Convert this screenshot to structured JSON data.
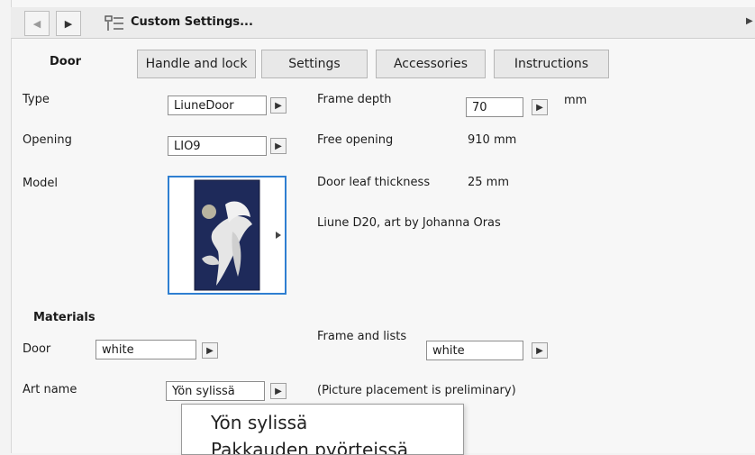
{
  "header": {
    "title": "Custom Settings...",
    "back_icon": "chevron-left",
    "forward_icon": "chevron-right",
    "settings_icon": "custom-settings-icon"
  },
  "tabs": [
    {
      "label": "Door",
      "active": true
    },
    {
      "label": "Handle and lock"
    },
    {
      "label": "Settings"
    },
    {
      "label": "Accessories"
    },
    {
      "label": "Instructions"
    }
  ],
  "left": {
    "type_label": "Type",
    "type_value": "LiuneDoor",
    "opening_label": "Opening",
    "opening_value": "LIO9",
    "model_label": "Model"
  },
  "right": {
    "frame_depth_label": "Frame depth",
    "frame_depth_value": "70",
    "frame_depth_unit": "mm",
    "free_opening_label": "Free opening",
    "free_opening_value": "910 mm",
    "door_leaf_label": "Door leaf thickness",
    "door_leaf_value": "25 mm",
    "model_caption": "Liune D20, art by Johanna Oras"
  },
  "materials": {
    "section_label": "Materials",
    "door_label": "Door",
    "door_value": "white",
    "frame_label": "Frame and lists",
    "frame_value": "white"
  },
  "art": {
    "label": "Art name",
    "value": "Yön sylissä",
    "note": "(Picture placement is preliminary)"
  },
  "dropdown": {
    "items": [
      "Yön sylissä",
      "Pakkauden pyörteissä"
    ]
  }
}
